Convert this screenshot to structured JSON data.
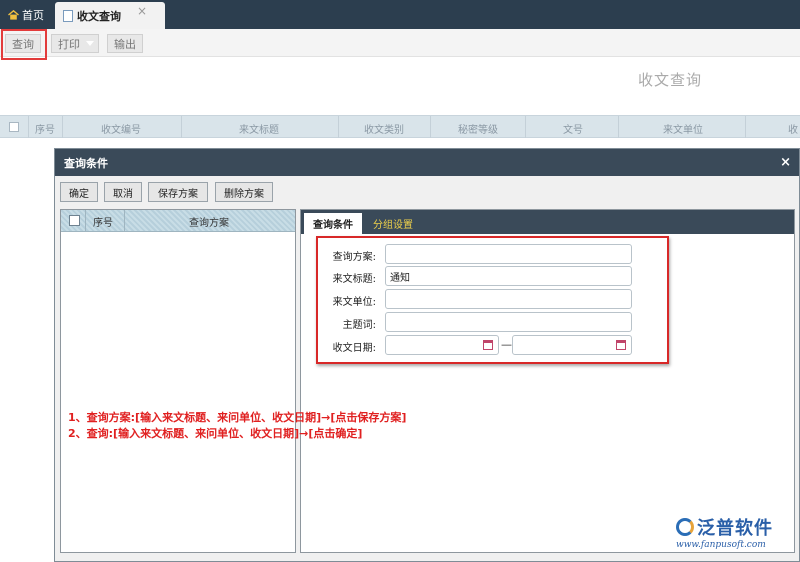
{
  "tabs": {
    "home": "首页",
    "active": "收文查询",
    "close": "×"
  },
  "toolbar": {
    "query": "查询",
    "print": "打印",
    "export": "输出"
  },
  "page_title": "收文查询",
  "grid": {
    "columns": [
      "序号",
      "收文编号",
      "来文标题",
      "收文类别",
      "秘密等级",
      "文号",
      "来文单位",
      "收"
    ]
  },
  "dialog": {
    "title": "查询条件",
    "close": "×",
    "buttons": {
      "ok": "确定",
      "cancel": "取消",
      "save": "保存方案",
      "delete": "删除方案"
    },
    "left_columns": {
      "seq": "序号",
      "scheme": "查询方案"
    },
    "right_tabs": {
      "active": "查询条件",
      "other": "分组设置"
    },
    "form": {
      "scheme_label": "查询方案:",
      "scheme_value": "",
      "title_label": "来文标题:",
      "title_value": "通知",
      "unit_label": "来文单位:",
      "unit_value": "",
      "keyword_label": "主题词:",
      "keyword_value": "",
      "date_label": "收文日期:",
      "date_sep": "—"
    }
  },
  "notes": [
    "1、查询方案:[输入来文标题、来问单位、收文日期]→[点击保存方案]",
    "2、查询:[输入来文标题、来问单位、收文日期]→[点击确定]"
  ],
  "logo": {
    "name": "泛普软件",
    "url": "www.fanpusoft.com"
  },
  "colors": {
    "header_bg": "#2c3e4f",
    "highlight": "#e23b3b",
    "note": "#e02020"
  }
}
